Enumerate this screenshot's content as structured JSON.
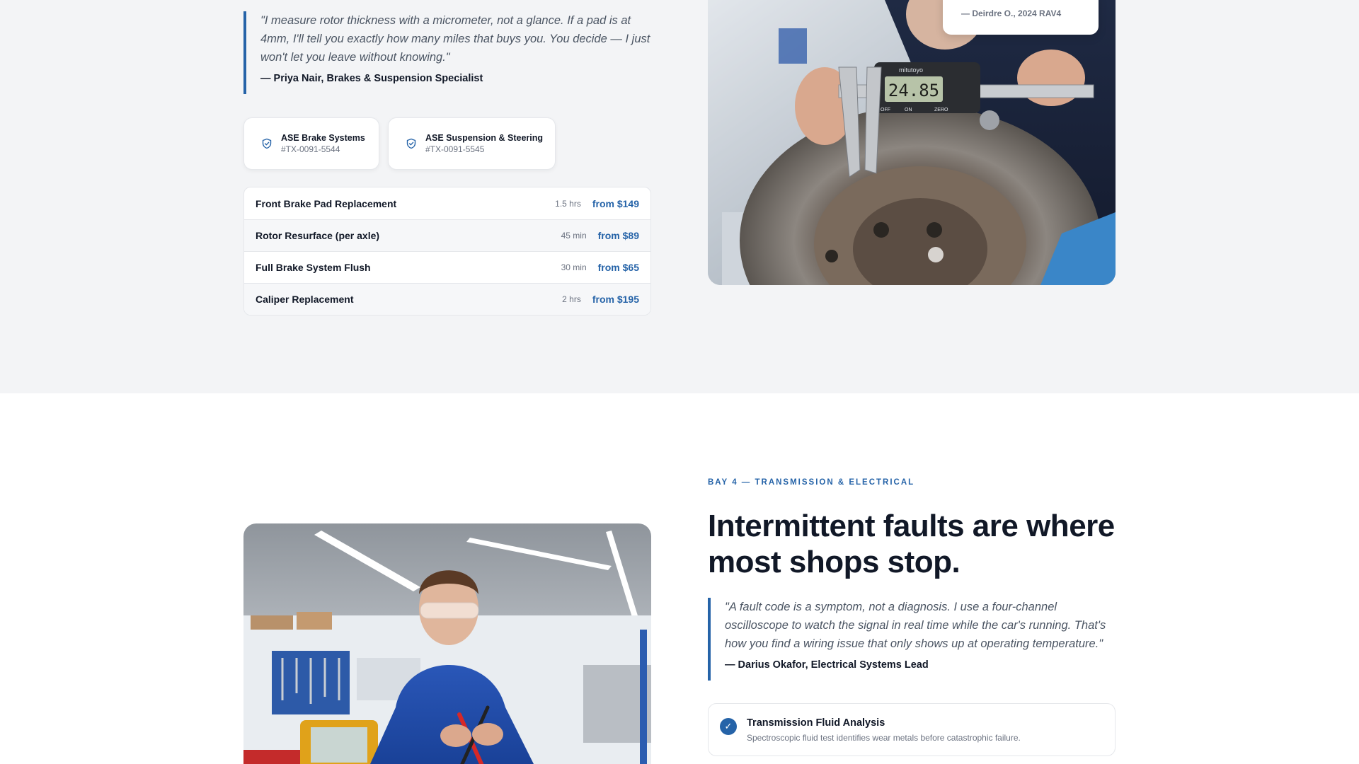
{
  "brakes": {
    "quote": "\"I measure rotor thickness with a micrometer, not a glance. If a pad is at 4mm, I'll tell you exactly how many miles that buys you. You decide — I just won't let you leave without knowing.\"",
    "author": "— Priya Nair, Brakes & Suspension Specialist",
    "certifications": [
      {
        "name": "ASE Brake Systems",
        "number": "#TX-0091-5544",
        "icon": "shield-icon"
      },
      {
        "name": "ASE Suspension & Steering",
        "number": "#TX-0091-5545",
        "icon": "shield-icon"
      }
    ],
    "services": [
      {
        "name": "Front Brake Pad Replacement",
        "time": "1.5 hrs",
        "price": "from $149"
      },
      {
        "name": "Rotor Resurface (per axle)",
        "time": "45 min",
        "price": "from $89"
      },
      {
        "name": "Full Brake System Flush",
        "time": "30 min",
        "price": "from $65"
      },
      {
        "name": "Caliper Replacement",
        "time": "2 hrs",
        "price": "from $195"
      }
    ],
    "photo": {
      "caliper_readout": "24.85",
      "caliper_brand": "mitutoyo",
      "caliper_buttons": [
        "OFF",
        "ON",
        "ZERO"
      ]
    },
    "review_author": "— Deirdre O., 2024 RAV4"
  },
  "electrical": {
    "eyebrow": "BAY 4 — TRANSMISSION & ELECTRICAL",
    "headline": "Intermittent faults are where most shops stop.",
    "quote": "\"A fault code is a symptom, not a diagnosis. I use a four-channel oscilloscope to watch the signal in real time while the car's running. That's how you find a wiring issue that only shows up at operating temperature.\"",
    "author": "— Darius Okafor, Electrical Systems Lead",
    "feature": {
      "title": "Transmission Fluid Analysis",
      "description": "Spectroscopic fluid test identifies wear metals before catastrophic failure.",
      "icon": "check-icon"
    }
  },
  "colors": {
    "accent": "#2563a8",
    "band_bg": "#f3f4f6",
    "text": "#111827",
    "muted": "#6b7280"
  }
}
